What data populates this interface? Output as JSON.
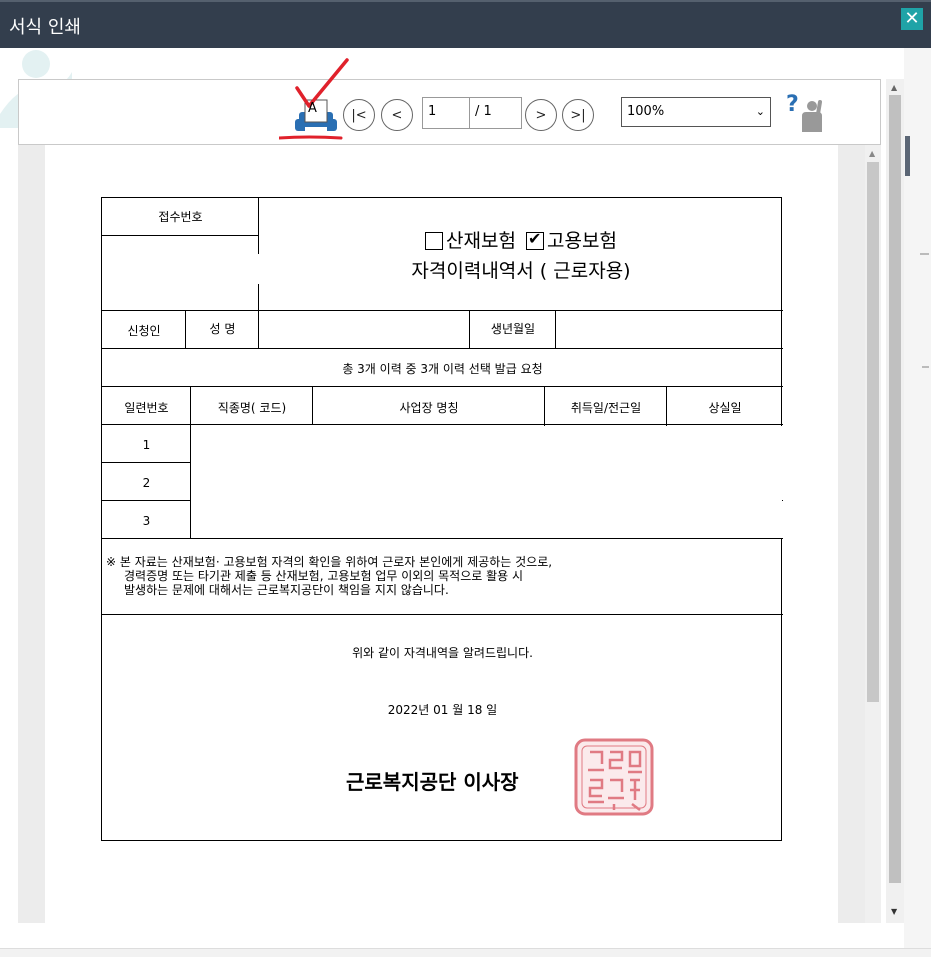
{
  "window": {
    "title": "서식 인쇄",
    "close_glyph": "✕"
  },
  "toolbar": {
    "print_icon_letter": "A",
    "first_glyph": "|<",
    "prev_glyph": "<",
    "next_glyph": ">",
    "last_glyph": ">|",
    "current_page": "1",
    "total_pages": "/ 1",
    "zoom": "100%",
    "zoom_chevron": "⌄",
    "help_glyph": "?"
  },
  "scroll": {
    "up": "▲",
    "down": "▼"
  },
  "form": {
    "receipt_no_label": "접수번호",
    "insurance_industrial": "산재보험",
    "insurance_employment": "고용보험",
    "industrial_checked": false,
    "employment_checked": true,
    "check_glyph": "✔",
    "doc_title": "자격이력내역서 ( 근로자용)",
    "applicant_label": "신청인",
    "name_label": "성 명",
    "birth_label": "생년월일",
    "summary": "총  3개 이력 중 3개 이력 선택 발급 요청",
    "columns": [
      "일련번호",
      "직종명( 코드)",
      "사업장 명칭",
      "취득일/전근일",
      "상실일"
    ],
    "rows": [
      "1",
      "2",
      "3"
    ],
    "note_lines": [
      "※ 본 자료는 산재보험· 고용보험 자격의 확인을 위하여 근로자 본인에게 제공하는 것으로,",
      "경력증명 또는 타기관 제출 등 산재보험, 고용보험 업무 이외의 목적으로 활용 시",
      "발생하는 문제에 대해서는 근로복지공단이 책임을 지지 않습니다."
    ],
    "confirm_text": "위와 같이 자격내역을 알려드립니다.",
    "date": "2022년 01 월 18 일",
    "signer": "근로복지공단  이사장",
    "seal_text": "근로복지공단이사장인"
  },
  "colors": {
    "titlebar": "#333e4d",
    "close": "#1fa3a7",
    "annotation": "#e0212b",
    "seal": "#e07a83",
    "help": "#2a6fb3"
  }
}
